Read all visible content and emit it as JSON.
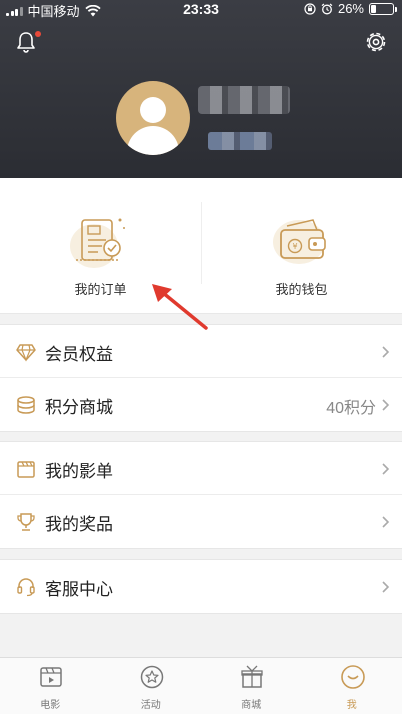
{
  "status_bar": {
    "carrier": "中国移动",
    "time": "23:33",
    "battery": "26%",
    "battery_level": 0.26
  },
  "header": {
    "bell_icon": "bell-icon",
    "settings_icon": "gear-icon",
    "avatar_icon": "avatar-icon"
  },
  "quick_actions": [
    {
      "label": "我的订单",
      "icon": "order-icon"
    },
    {
      "label": "我的钱包",
      "icon": "wallet-icon"
    }
  ],
  "menu": {
    "group1": [
      {
        "label": "会员权益",
        "icon": "diamond-icon",
        "value": ""
      },
      {
        "label": "积分商城",
        "icon": "coins-icon",
        "value": "40积分"
      }
    ],
    "group2": [
      {
        "label": "我的影单",
        "icon": "clapperboard-icon",
        "value": ""
      },
      {
        "label": "我的奖品",
        "icon": "trophy-icon",
        "value": ""
      }
    ],
    "group3": [
      {
        "label": "客服中心",
        "icon": "headset-icon",
        "value": ""
      }
    ]
  },
  "tabbar": [
    {
      "label": "电影",
      "icon": "film-icon",
      "active": false
    },
    {
      "label": "活动",
      "icon": "star-icon",
      "active": false
    },
    {
      "label": "商城",
      "icon": "gift-icon",
      "active": false
    },
    {
      "label": "我",
      "icon": "user-icon",
      "active": true
    }
  ],
  "colors": {
    "accent": "#c89a56",
    "header_bg": "#2f3137",
    "notification": "#e84a3a",
    "annotation_arrow": "#e03a2e"
  }
}
